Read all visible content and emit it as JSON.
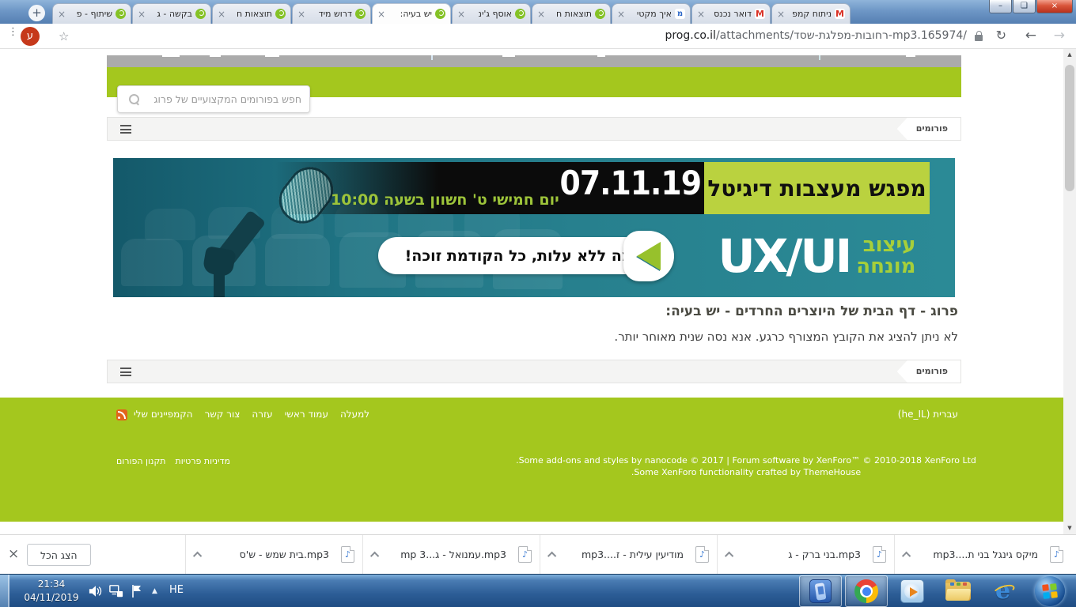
{
  "colors": {
    "lime_green": "#a4c71e",
    "banner_lime": "#bad23f",
    "banner_teal": "#27808e",
    "taskbar_blue": "#2c5d96",
    "close_red": "#c03022",
    "avatar_red": "#c6391b"
  },
  "browser": {
    "new_tab_label": "+",
    "tabs": [
      {
        "label": "שיתוף - פ",
        "icon": "prog"
      },
      {
        "label": "בקשה - ג",
        "icon": "prog"
      },
      {
        "label": "תוצאות ח",
        "icon": "prog"
      },
      {
        "label": "דרוש מיד",
        "icon": "prog"
      },
      {
        "label": "יש בעיה:",
        "icon": "prog"
      },
      {
        "label": "אוסף ג'ינ",
        "icon": "prog"
      },
      {
        "label": "תוצאות ח",
        "icon": "prog"
      },
      {
        "label": "איך מקטי",
        "icon": "mem"
      },
      {
        "label": "דואר נכנס",
        "icon": "gmail"
      },
      {
        "label": "ניתוח קמפ",
        "icon": "gmail"
      }
    ],
    "tab_close_glyph": "×",
    "gmail_glyph": "M",
    "mem_glyph": "מ",
    "window_controls": {
      "minimize": "–",
      "maximize": "❏",
      "close": "×"
    },
    "url": {
      "host": "prog.co.il",
      "path": "/attachments/רחובות-מפלגת-שסד-mp3.165974/"
    },
    "avatar_letter": "ע",
    "star_glyph": "☆",
    "menu_glyph": "⋮",
    "reload_glyph": "↻",
    "back_glyph": "←",
    "forward_glyph": "→",
    "scrollbar": {
      "up_glyph": "▲",
      "down_glyph": "▼"
    }
  },
  "page": {
    "search_placeholder": "חפש בפורומים המקצועיים של פרוג",
    "breadcrumb_label": "פורומים",
    "banner": {
      "title": "מפגש מעצבות דיגיטל",
      "date": "07.11.19",
      "subtitle": "יום חמישי ט' חשוון בשעה 10:00",
      "big_text": "UX/UI",
      "side_line1": "עיצוב",
      "side_line2": "מונחה",
      "cta": "הרשמה ללא עלות, כל הקודמת זוכה!"
    },
    "error_title": "פרוג - דף הבית של היוצרים החרדים - יש בעיה:",
    "error_body": "לא ניתן להציג את הקובץ המצורף כרגע. אנא נסה שנית מאוחר יותר.",
    "footer": {
      "links": [
        {
          "label": "הקמפיינים שלי"
        },
        {
          "label": "צור קשר"
        },
        {
          "label": "עזרה"
        },
        {
          "label": "עמוד ראשי"
        },
        {
          "label": "למעלה"
        }
      ],
      "language": "עברית (he_IL)",
      "copyright_line1": "Some add-ons and styles by nanocode © 2017 | Forum software by XenForo™ © 2010-2018 XenForo Ltd.",
      "copyright_line2": "Some XenForo functionality crafted by ThemeHouse.",
      "legal_links": [
        {
          "label": "תקנון הפורום"
        },
        {
          "label": "מדיניות פרטיות"
        }
      ]
    }
  },
  "downloads": {
    "show_all_label": "הצג הכל",
    "close_glyph": "×",
    "note_glyph": "♪",
    "items": [
      {
        "parts": {
          "left": "mp3....",
          "mid": "מיקס גינגל בני ת",
          "right": ""
        }
      },
      {
        "parts": {
          "left": "",
          "mid": "בני ברק - ג",
          "right": ".mp3"
        }
      },
      {
        "parts": {
          "left": "mp3....",
          "mid": "מודיעין עילית - ז",
          "right": ""
        }
      },
      {
        "parts": {
          "left": "mp  3...",
          "mid": "עמנואל - ג",
          "right": ".mp3"
        }
      },
      {
        "parts": {
          "left": "",
          "mid": "בית שמש - ש'ס",
          "right": ".mp3"
        }
      }
    ]
  },
  "taskbar": {
    "time": "21:34",
    "date": "04/11/2019",
    "language": "HE",
    "overflow_glyph": "▲"
  }
}
